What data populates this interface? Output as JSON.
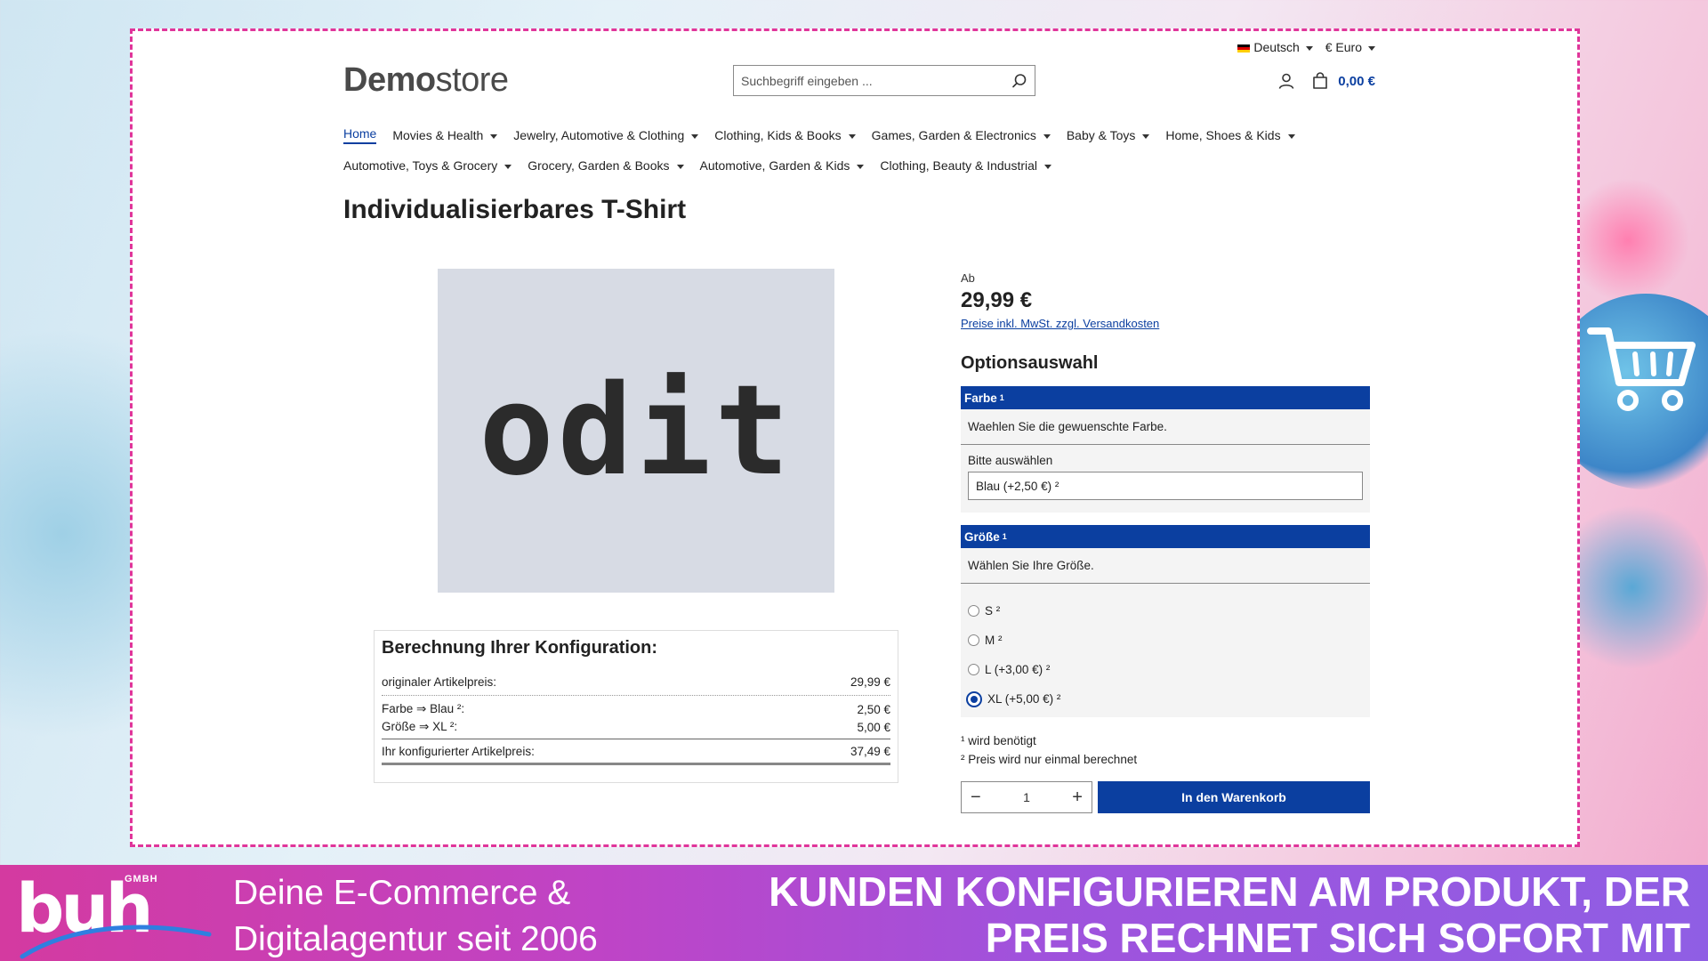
{
  "topbar": {
    "language": "Deutsch",
    "currency": "€ Euro"
  },
  "logo": {
    "bold": "Demo",
    "light": "store"
  },
  "search": {
    "placeholder": "Suchbegriff eingeben ..."
  },
  "cart": {
    "total": "0,00 €"
  },
  "nav": {
    "row1": [
      "Home",
      "Movies & Health",
      "Jewelry, Automotive & Clothing",
      "Clothing, Kids & Books",
      "Games, Garden & Electronics",
      "Baby & Toys",
      "Home, Shoes & Kids"
    ],
    "row2": [
      "Automotive, Toys & Grocery",
      "Grocery, Garden & Books",
      "Automotive, Garden & Kids",
      "Clothing, Beauty & Industrial"
    ]
  },
  "product": {
    "title": "Individualisierbares T-Shirt",
    "image_text": "odit",
    "price_prefix": "Ab",
    "price": "29,99 €",
    "price_note": "Preise inkl. MwSt. zzgl. Versandkosten"
  },
  "calc": {
    "title": "Berechnung Ihrer Konfiguration:",
    "original_label": "originaler Artikelpreis:",
    "original_value": "29,99 €",
    "items": [
      {
        "label": "Farbe ⇒ Blau ²:",
        "value": "2,50 €"
      },
      {
        "label": "Größe ⇒ XL ²:",
        "value": "5,00 €"
      }
    ],
    "total_label": "Ihr konfigurierter Artikelpreis:",
    "total_value": "37,49 €"
  },
  "options": {
    "title": "Optionsauswahl",
    "color": {
      "header": "Farbe",
      "sup": "1",
      "desc": "Waehlen Sie die gewuenschte Farbe.",
      "select_label": "Bitte auswählen",
      "selected": "Blau (+2,50 €) ²"
    },
    "size": {
      "header": "Größe",
      "sup": "1",
      "desc": "Wählen Sie Ihre Größe.",
      "choices": [
        {
          "label": "S ²",
          "checked": false
        },
        {
          "label": "M ²",
          "checked": false
        },
        {
          "label": "L (+3,00 €) ²",
          "checked": false
        },
        {
          "label": "XL (+5,00 €) ²",
          "checked": true
        }
      ]
    },
    "note1": "¹ wird benötigt",
    "note2": "² Preis wird nur einmal berechnet"
  },
  "buy": {
    "quantity": "1",
    "minus": "−",
    "plus": "+",
    "button": "In den Warenkorb"
  },
  "banner": {
    "logo_text": "buh",
    "logo_suffix": "GMBH",
    "left_line1": "Deine E-Commerce &",
    "left_line2": "Digitalagentur seit 2006",
    "right_line1": "KUNDEN KONFIGURIEREN AM PRODUKT, DER",
    "right_line2": "PREIS RECHNET SICH SOFORT MIT"
  },
  "colors": {
    "primary": "#0b3fa0",
    "frame": "#e0359a",
    "banner_start": "#d43aa0",
    "banner_end": "#8f5ee4"
  }
}
